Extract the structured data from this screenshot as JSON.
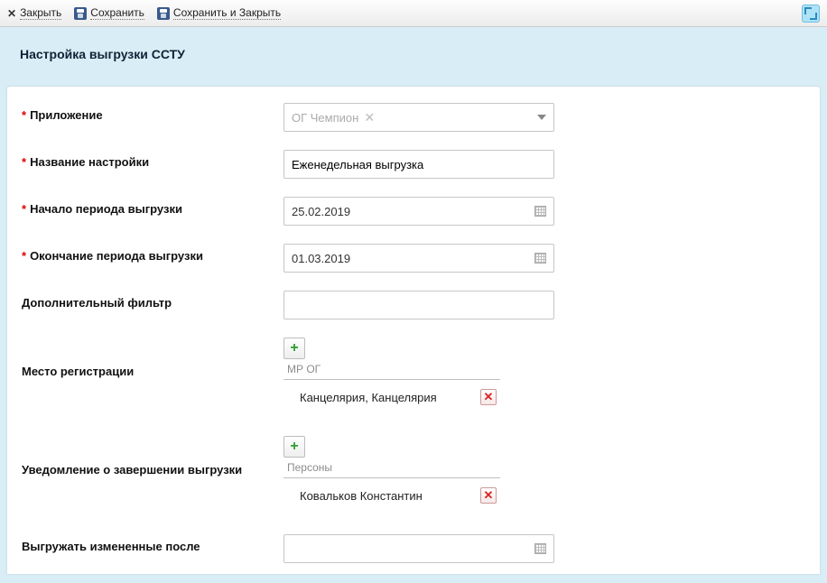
{
  "toolbar": {
    "close": "Закрыть",
    "save": "Сохранить",
    "save_close": "Сохранить и Закрыть"
  },
  "header": {
    "title": "Настройка выгрузки ССТУ"
  },
  "labels": {
    "app": "Приложение",
    "settings_name": "Название настройки",
    "period_start": "Начало периода выгрузки",
    "period_end": "Окончание периода выгрузки",
    "extra_filter": "Дополнительный фильтр",
    "reg_place": "Место регистрации",
    "notify": "Уведомление о завершении выгрузки",
    "changed_after": "Выгружать измененные после"
  },
  "values": {
    "app": "ОГ Чемпион",
    "settings_name": "Еженедельная выгрузка",
    "period_start": "25.02.2019",
    "period_end": "01.03.2019",
    "extra_filter": "",
    "changed_after": ""
  },
  "reg_place": {
    "header": "МР ОГ",
    "items": [
      "Канцелярия, Канцелярия"
    ]
  },
  "notify": {
    "header": "Персоны",
    "items": [
      "Ковальков Константин"
    ]
  }
}
